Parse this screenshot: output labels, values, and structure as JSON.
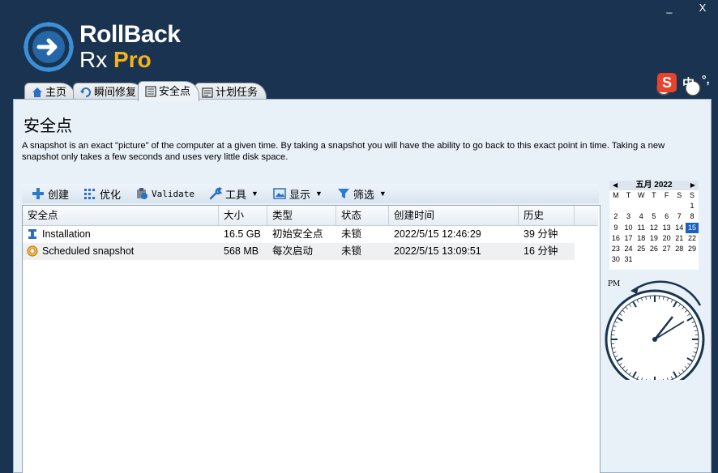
{
  "window": {
    "minimize": "_",
    "close": "X"
  },
  "logo": {
    "line1": "RollBack",
    "line2_prefix": "Rx",
    "line2_suffix": "Pro"
  },
  "tabs": [
    {
      "label": "主页",
      "icon": "home-icon"
    },
    {
      "label": "瞬间修复",
      "icon": "restore-icon"
    },
    {
      "label": "安全点",
      "icon": "snapshot-list-icon",
      "active": true
    },
    {
      "label": "计划任务",
      "icon": "schedule-icon"
    }
  ],
  "ime": {
    "brand": "S",
    "lang": "中",
    "punct": "°,"
  },
  "page": {
    "title": "安全点",
    "description": "A snapshot is an exact \"picture\" of the computer at a given time. By taking a snapshot you will have the ability to go back to this exact point in time. Taking a new snapshot only takes a few seconds and uses very little disk space."
  },
  "toolbar": {
    "create": "创建",
    "optimize": "优化",
    "validate": "Validate",
    "tools": "工具",
    "display": "显示",
    "filter": "筛选"
  },
  "table": {
    "headers": [
      "安全点",
      "大小",
      "类型",
      "状态",
      "创建时间",
      "历史"
    ],
    "rows": [
      {
        "name": "Installation",
        "size": "16.5 GB",
        "type": "初始安全点",
        "status": "未锁",
        "created": "2022/5/15 12:46:29",
        "age": "39 分钟"
      },
      {
        "name": "Scheduled snapshot",
        "size": "568 MB",
        "type": "每次启动",
        "status": "未锁",
        "created": "2022/5/15 13:09:51",
        "age": "16 分钟"
      }
    ]
  },
  "calendar": {
    "month_label": "五月 2022",
    "dows": [
      "M",
      "T",
      "W",
      "T",
      "F",
      "S",
      "S"
    ],
    "weeks": [
      [
        "",
        "",
        "",
        "",
        "",
        "",
        "1"
      ],
      [
        "2",
        "3",
        "4",
        "5",
        "6",
        "7",
        "8"
      ],
      [
        "9",
        "10",
        "11",
        "12",
        "13",
        "14",
        "15"
      ],
      [
        "16",
        "17",
        "18",
        "19",
        "20",
        "21",
        "22"
      ],
      [
        "23",
        "24",
        "25",
        "26",
        "27",
        "28",
        "29"
      ],
      [
        "30",
        "31",
        "",
        "",
        "",
        "",
        ""
      ]
    ],
    "today": "15"
  },
  "clock": {
    "period": "PM"
  },
  "colors": {
    "background": "#1a3350",
    "accent_yellow": "#f5b21b",
    "today": "#1a60c0",
    "panel": "#e8f0f8"
  }
}
